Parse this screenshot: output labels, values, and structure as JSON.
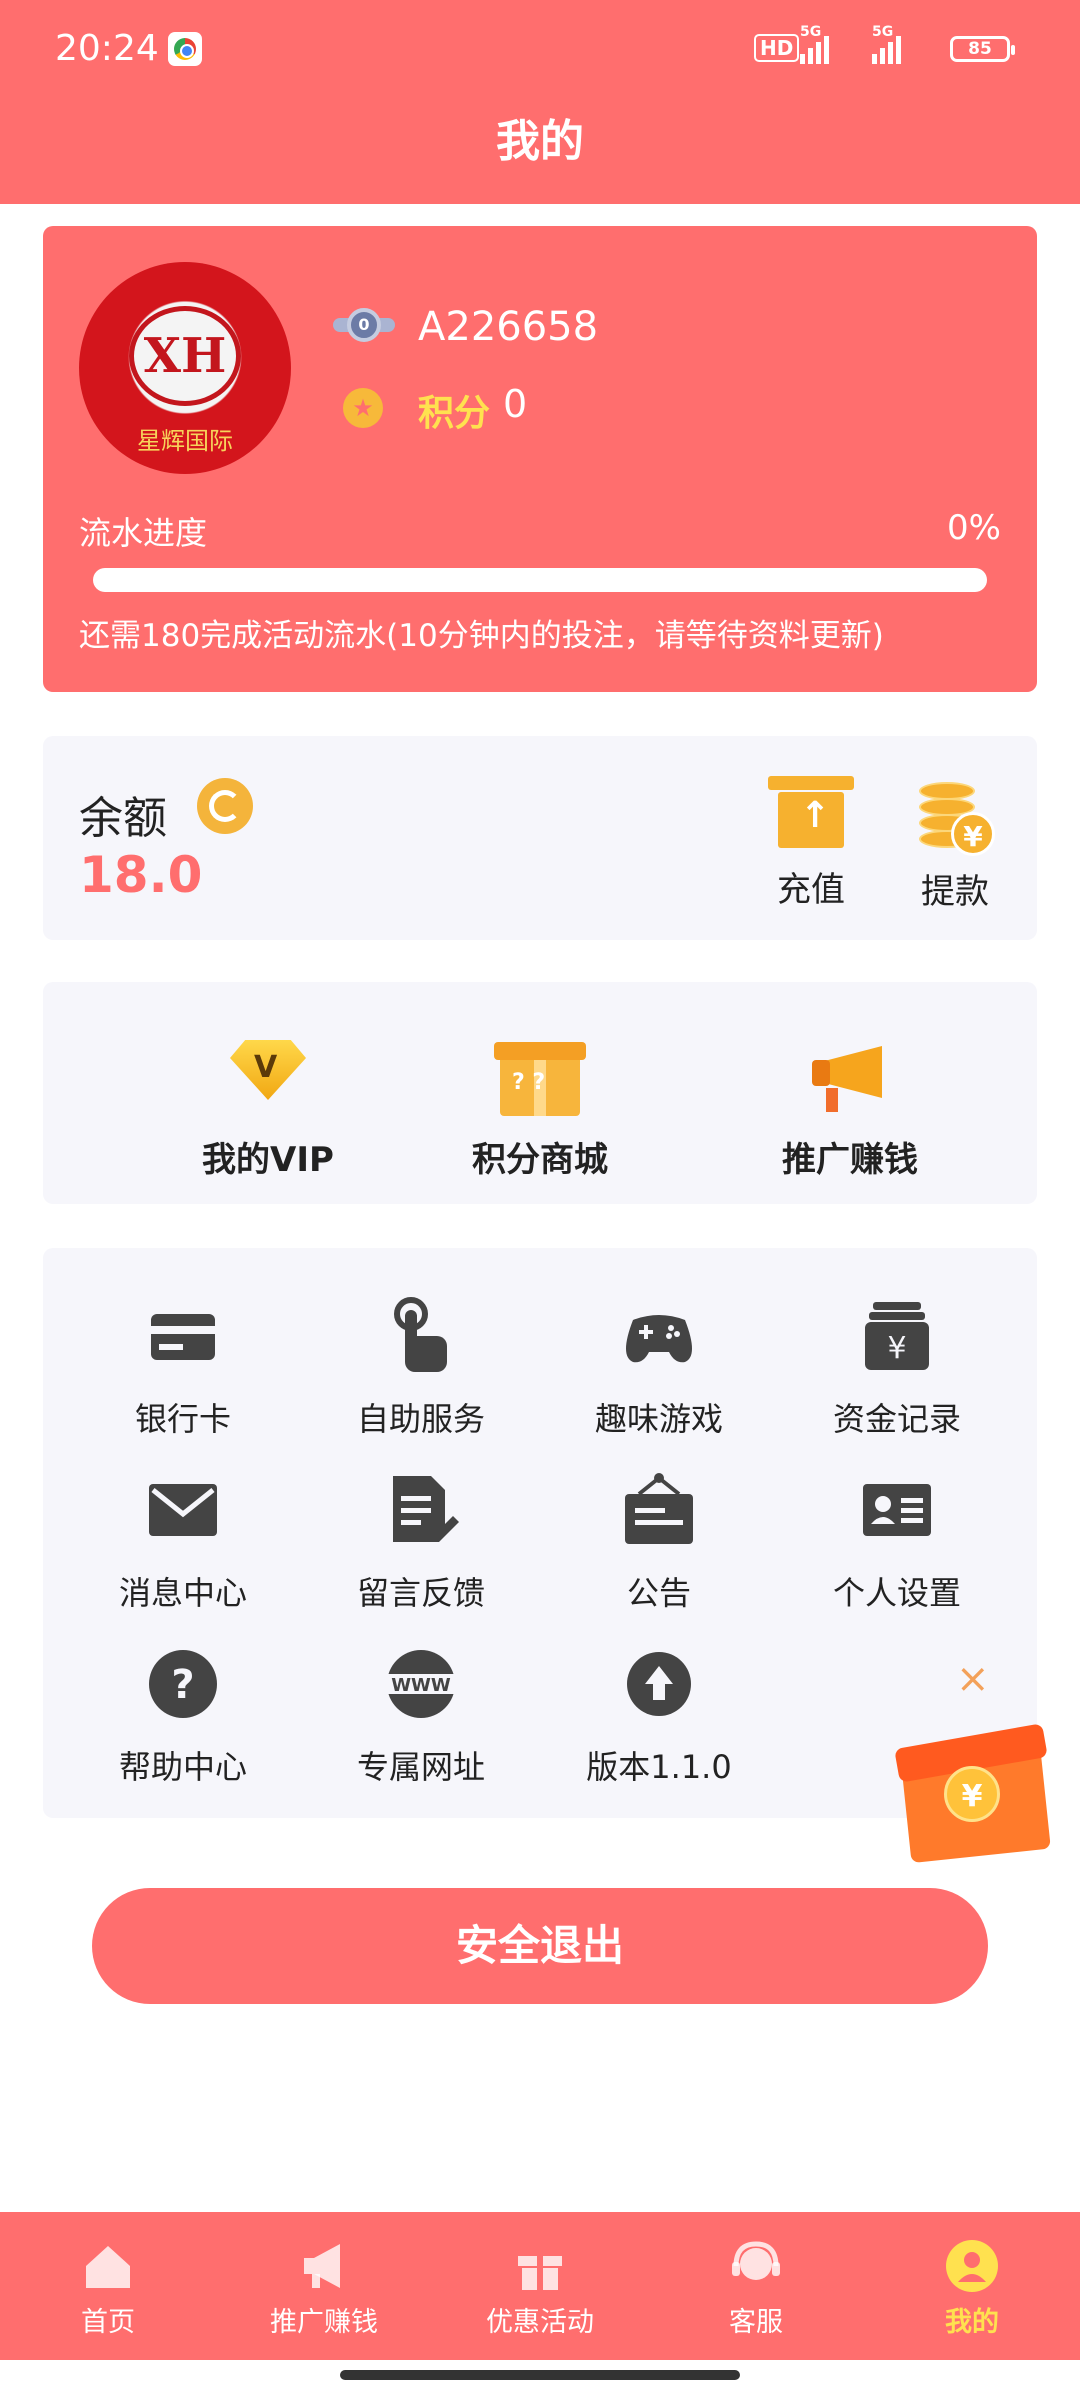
{
  "status_bar": {
    "time": "20:24",
    "network_hd": "HD",
    "signal1": "5G",
    "signal2": "5G",
    "battery": "85"
  },
  "header": {
    "title": "我的"
  },
  "profile": {
    "avatar_caption": "星辉国际",
    "avatar_monogram": "XH",
    "level": "0",
    "username": "A226658",
    "points_label": "积分",
    "points_value": "0",
    "flow_label": "流水进度",
    "flow_percent_text": "0%",
    "flow_progress": 0,
    "flow_note": "还需180完成活动流水(10分钟内的投注，请等待资料更新)"
  },
  "balance": {
    "label": "余额",
    "value": "18.0",
    "recharge_label": "充值",
    "withdraw_label": "提款"
  },
  "features": [
    {
      "label": "我的VIP",
      "icon": "vip-diamond-icon"
    },
    {
      "label": "积分商城",
      "icon": "gift-box-icon"
    },
    {
      "label": "推广赚钱",
      "icon": "megaphone-icon"
    }
  ],
  "services": [
    {
      "label": "银行卡",
      "icon": "bank-card-icon"
    },
    {
      "label": "自助服务",
      "icon": "tap-hand-icon"
    },
    {
      "label": "趣味游戏",
      "icon": "gamepad-icon"
    },
    {
      "label": "资金记录",
      "icon": "yuan-record-icon"
    },
    {
      "label": "消息中心",
      "icon": "envelope-icon"
    },
    {
      "label": "留言反馈",
      "icon": "edit-document-icon"
    },
    {
      "label": "公告",
      "icon": "notice-board-icon"
    },
    {
      "label": "个人设置",
      "icon": "id-card-icon"
    },
    {
      "label": "帮助中心",
      "icon": "help-icon"
    },
    {
      "label": "专属网址",
      "icon": "www-globe-icon"
    },
    {
      "label": "版本1.1.0",
      "icon": "upgrade-arrow-icon"
    }
  ],
  "floating_gift": {
    "coin_symbol": "¥",
    "close_symbol": "×"
  },
  "logout": {
    "label": "安全退出"
  },
  "tabbar": [
    {
      "label": "首页",
      "icon": "home-icon",
      "active": false
    },
    {
      "label": "推广赚钱",
      "icon": "megaphone-icon",
      "active": false
    },
    {
      "label": "优惠活动",
      "icon": "gift-icon",
      "active": false
    },
    {
      "label": "客服",
      "icon": "headset-icon",
      "active": false
    },
    {
      "label": "我的",
      "icon": "user-icon",
      "active": true
    }
  ],
  "colors": {
    "primary": "#ff6e6e",
    "accent": "#ffe14f",
    "gold": "#f6b12f",
    "card_bg": "#f6f6fb"
  }
}
